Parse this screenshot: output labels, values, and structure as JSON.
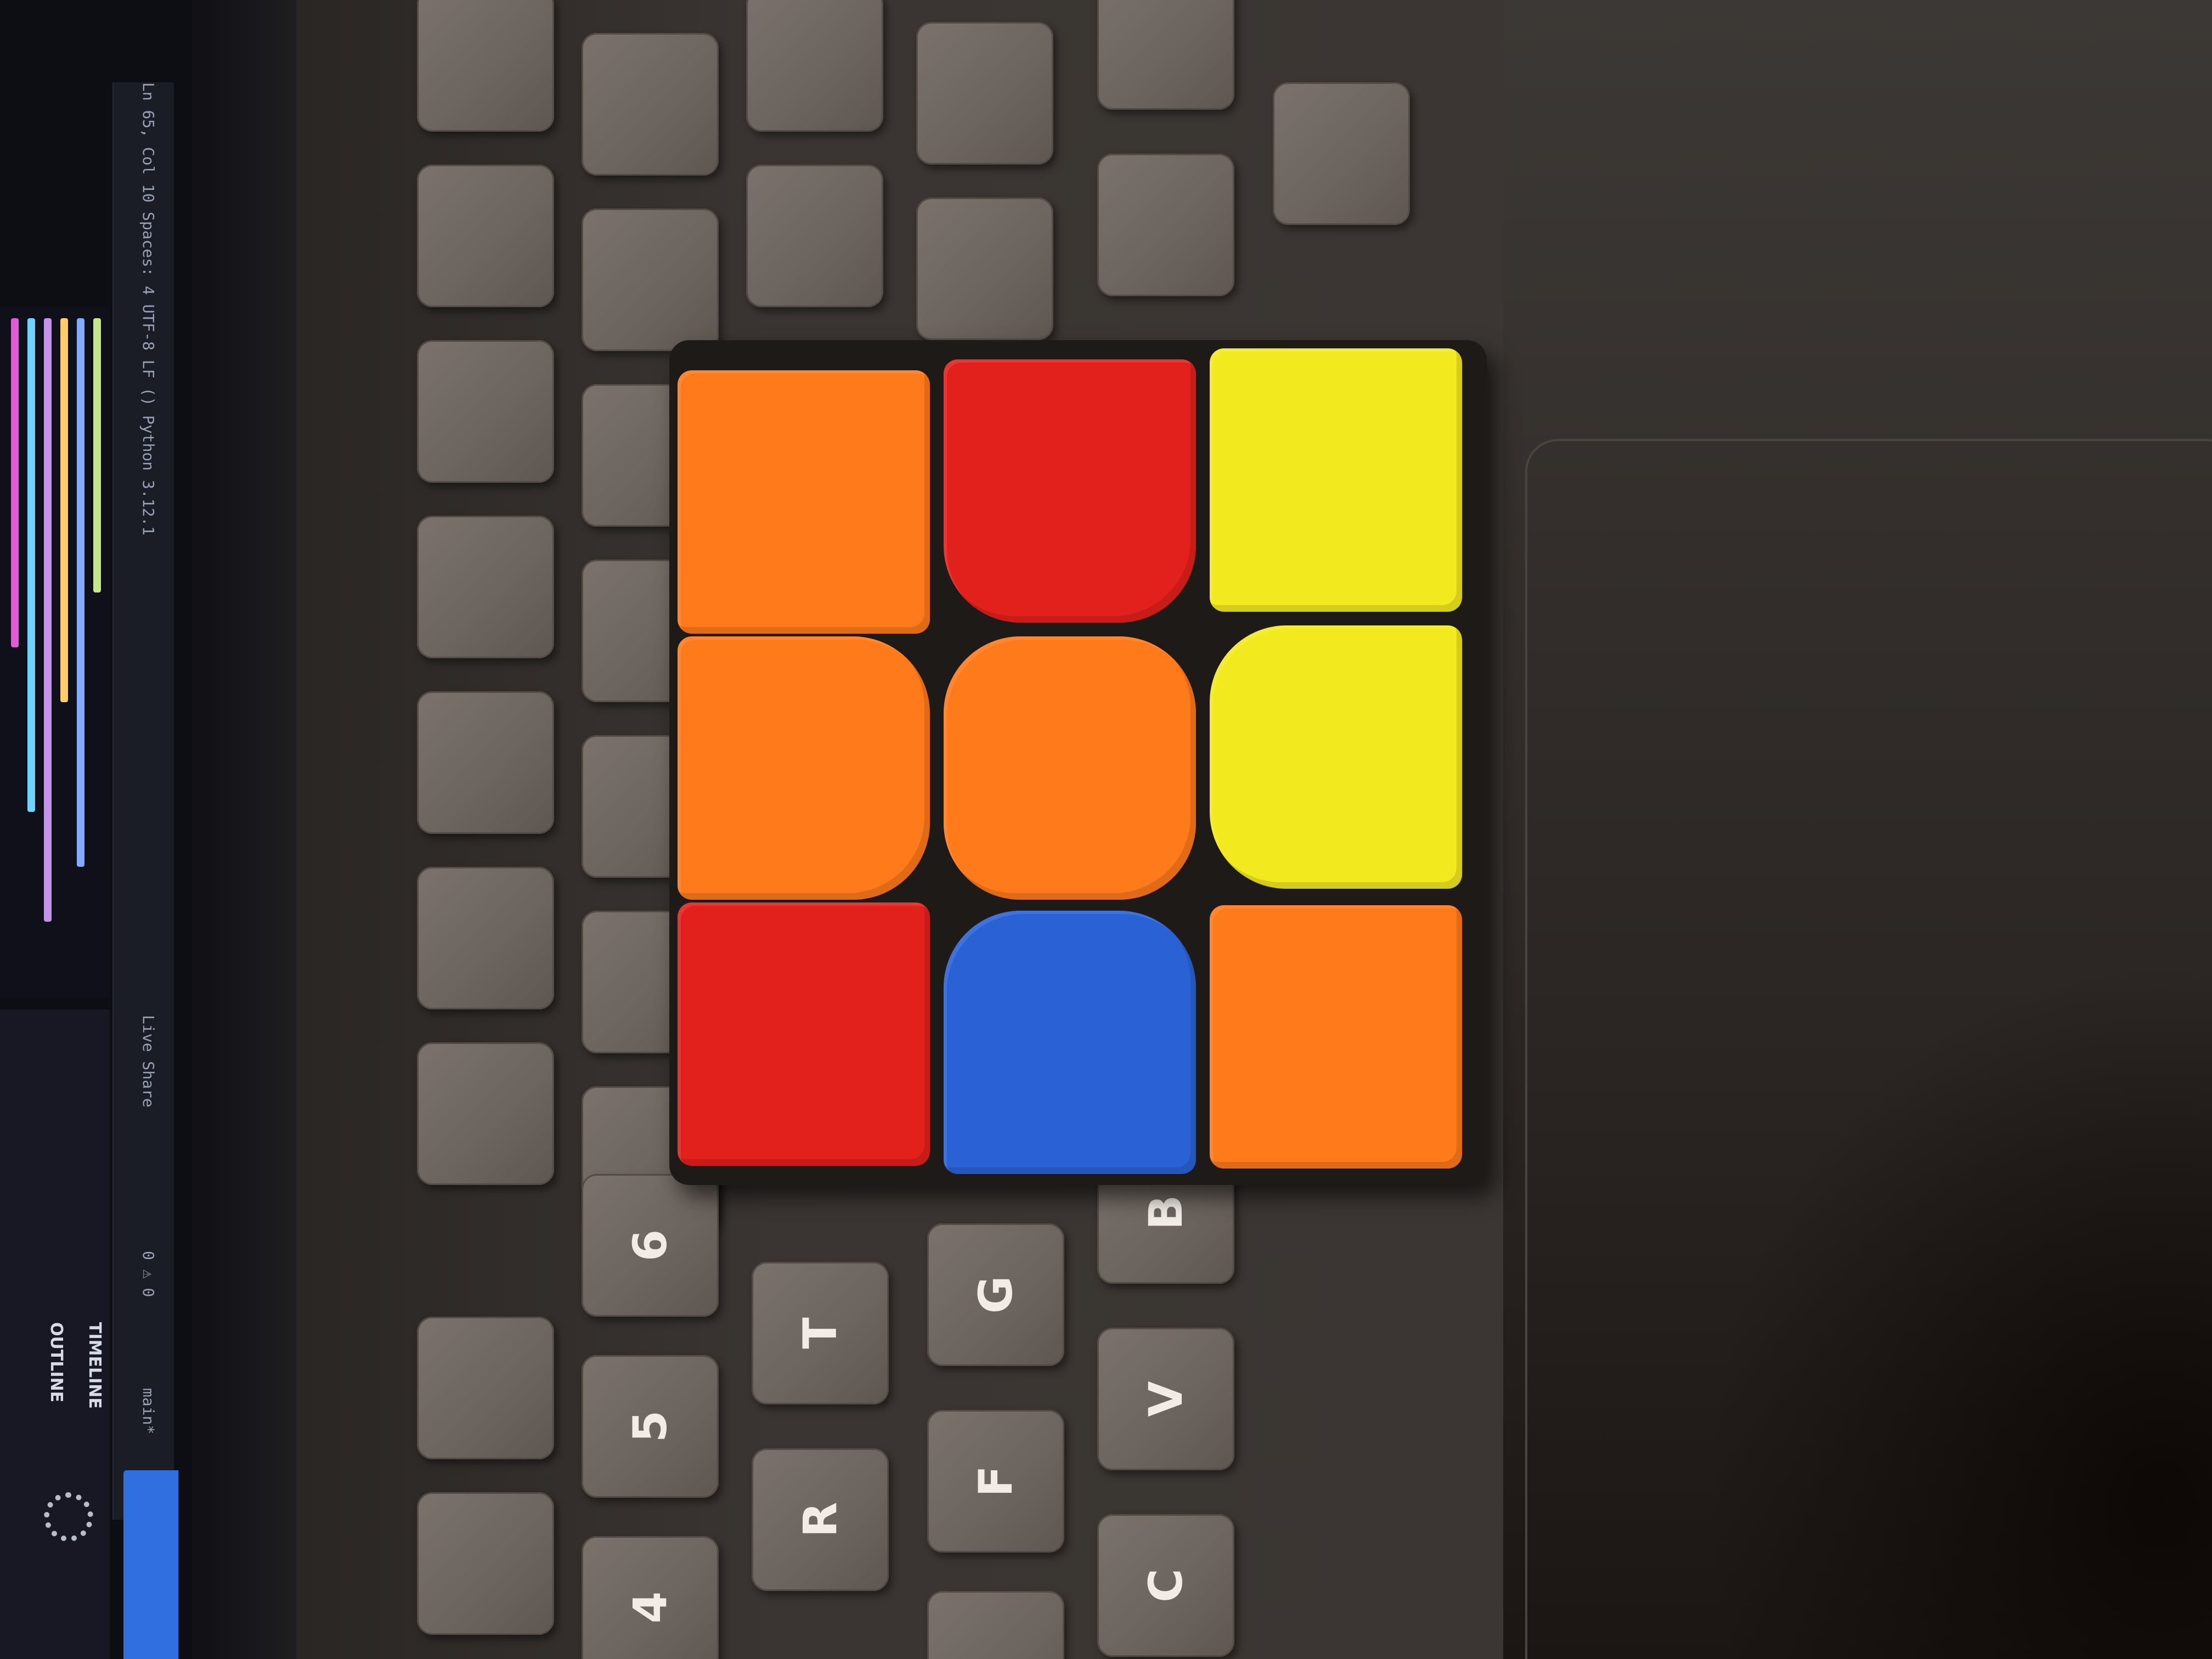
{
  "screen": {
    "status_text": "Ln 65, Col 10  Spaces: 4  UTF-8  LF  () Python  3.12.1",
    "outline_label": "OUTLINE",
    "timeline_label": "TIMELINE",
    "branch_label": "main*",
    "errors_label": "0 ⚠ 0",
    "live_share_label": "Live Share"
  },
  "keyboard": {
    "keys": [
      "B",
      "V",
      "C",
      "G",
      "F",
      "T",
      "R",
      "6",
      "5",
      "4"
    ]
  },
  "cube": {
    "grid": [
      [
        "orange",
        "red",
        "yellow"
      ],
      [
        "orange",
        "orange",
        "yellow"
      ],
      [
        "red",
        "blue",
        "orange"
      ]
    ],
    "colors": {
      "orange": "#ff7a1a",
      "red": "#e2211c",
      "yellow": "#f2ea1f",
      "blue": "#2a62d6"
    }
  }
}
